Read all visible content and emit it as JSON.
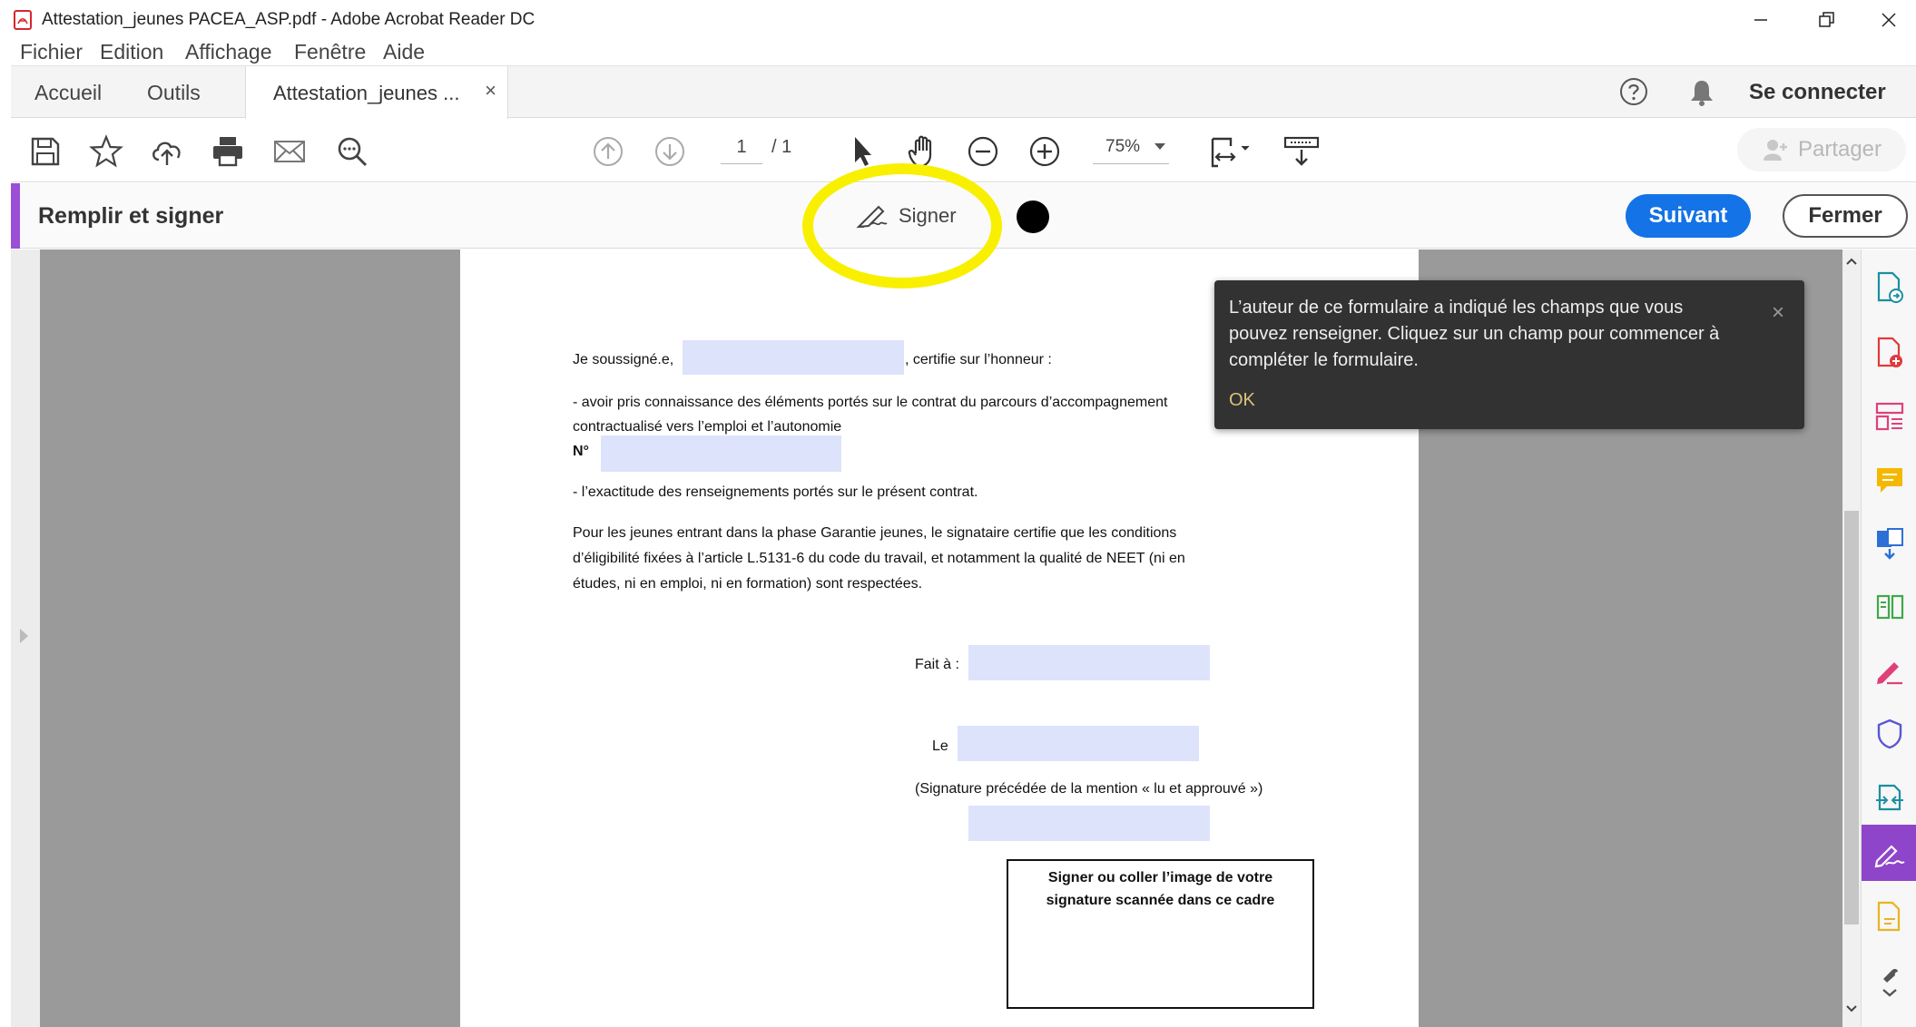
{
  "window": {
    "title": "Attestation_jeunes PACEA_ASP.pdf - Adobe Acrobat Reader DC"
  },
  "menu": {
    "items": [
      "Fichier",
      "Edition",
      "Affichage",
      "Fenêtre",
      "Aide"
    ]
  },
  "tabs": {
    "home": "Accueil",
    "tools": "Outils",
    "document": "Attestation_jeunes ...",
    "close_symbol": "×",
    "sign_in": "Se connecter"
  },
  "toolbar": {
    "page_current": "1",
    "page_total": "/ 1",
    "zoom": "75%",
    "share": "Partager"
  },
  "fill_sign": {
    "label": "Remplir et signer",
    "sign_tool": "Signer",
    "next": "Suivant",
    "close": "Fermer",
    "ink_color": "#000000",
    "accent_color": "#9b4fd6"
  },
  "document": {
    "line1_prefix": "Je soussigné.e,",
    "line1_suffix": ", certifie sur l’honneur :",
    "bullet1_line1": "- avoir pris connaissance des éléments portés sur le contrat du parcours d’accompagnement",
    "bullet1_line2": "contractualisé vers l’emploi et l’autonomie",
    "number_label": "N°",
    "bullet2": "- l’exactitude des renseignements portés sur le présent contrat.",
    "para_line1": "Pour les jeunes entrant dans la phase Garantie jeunes, le signataire certifie que les conditions",
    "para_line2": "d’éligibilité fixées à l’article L.5131-6 du code du travail, et notamment la qualité de NEET (ni en",
    "para_line3": "études, ni en emploi, ni en formation) sont respectées.",
    "fait_a": "Fait à :",
    "le": "Le",
    "signature_note": "(Signature précédée de la mention « lu et approuvé »)",
    "sigbox_line1": "Signer ou coller l’image de votre",
    "sigbox_line2": "signature scannée dans ce cadre"
  },
  "tooltip": {
    "message": "L’auteur de ce formulaire a indiqué les champs que vous pouvez renseigner. Cliquez sur un champ pour commencer à compléter le formulaire.",
    "ok": "OK",
    "close_symbol": "×"
  },
  "scrollbar": {
    "up": "^",
    "down": "v"
  },
  "right_panel": {
    "tools": [
      "export-pdf-icon",
      "create-pdf-icon",
      "edit-pdf-icon",
      "comment-icon",
      "combine-files-icon",
      "organize-pages-icon",
      "fill-sign-pen-icon",
      "protect-icon",
      "send-for-review-icon",
      "fill-sign-active-icon",
      "send-for-signature-icon",
      "more-tools-icon"
    ]
  }
}
